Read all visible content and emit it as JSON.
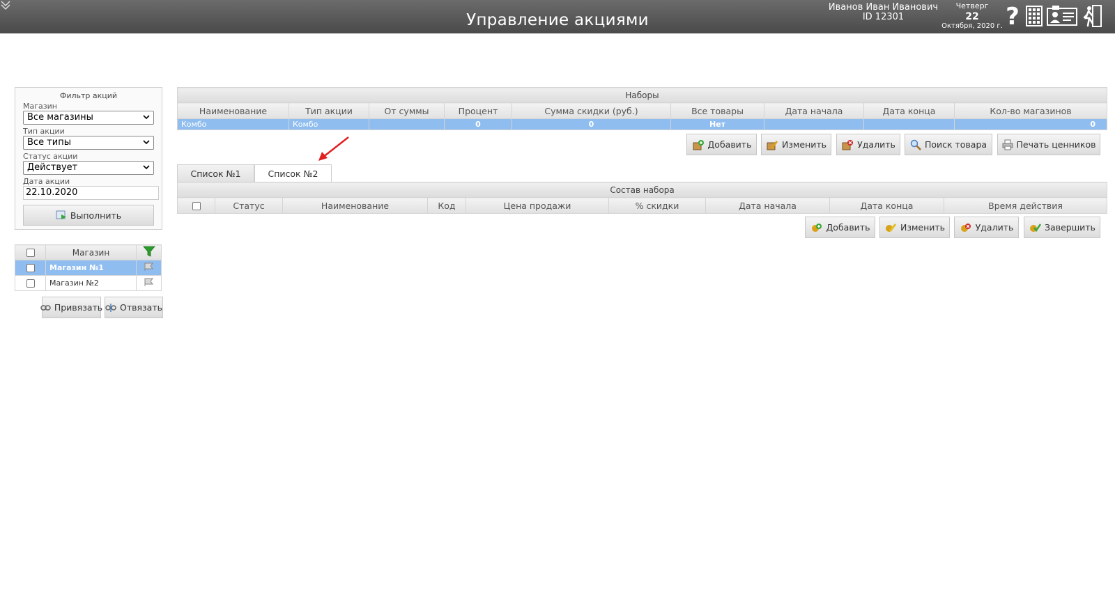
{
  "header": {
    "title": "Управление акциями",
    "user_name": "Иванов Иван Иванович",
    "user_id": "ID 12301",
    "date_weekday": "Четверг",
    "date_day": "22",
    "date_month": "Октября, 2020 г.",
    "help_glyph": "?",
    "icons": [
      "collapse-arrow-icon",
      "help-icon",
      "calculator-icon",
      "id-card-icon",
      "exit-icon"
    ]
  },
  "filter": {
    "title": "Фильтр акций",
    "store_label": "Магазин",
    "store_value": "Все магазины",
    "type_label": "Тип акции",
    "type_value": "Все типы",
    "status_label": "Статус акции",
    "status_value": "Действует",
    "date_label": "Дата акции",
    "date_value": "22.10.2020",
    "run_button": "Выполнить"
  },
  "stores": {
    "header": "Магазин",
    "rows": [
      {
        "name": "Магазин №1",
        "selected": true
      },
      {
        "name": "Магазин №2",
        "selected": false
      }
    ],
    "bind_button": "Привязать",
    "unbind_button": "Отвязать"
  },
  "sets": {
    "caption": "Наборы",
    "columns": [
      "Наименование",
      "Тип акции",
      "От суммы",
      "Процент",
      "Сумма скидки (руб.)",
      "Все товары",
      "Дата начала",
      "Дата конца",
      "Кол-во магазинов"
    ],
    "rows": [
      {
        "name": "Комбо",
        "type": "Комбо",
        "from_sum": "",
        "percent": "0",
        "discount_sum": "0",
        "all_goods": "Нет",
        "date_start": "",
        "date_end": "",
        "store_count": "0"
      }
    ],
    "buttons": {
      "add": "Добавить",
      "edit": "Изменить",
      "delete": "Удалить",
      "search": "Поиск товара",
      "print": "Печать ценников"
    }
  },
  "tabs": [
    "Список №1",
    "Список №2"
  ],
  "active_tab": "Список №2",
  "composition": {
    "caption": "Состав набора",
    "columns": [
      "",
      "Статус",
      "Наименование",
      "Код",
      "Цена продажи",
      "% скидки",
      "Дата начала",
      "Дата конца",
      "Время действия"
    ],
    "buttons": {
      "add": "Добавить",
      "edit": "Изменить",
      "delete": "Удалить",
      "finish": "Завершить"
    }
  },
  "colors": {
    "header_bg": "#555555",
    "selected_row": "#8fbdf0",
    "annotation_arrow": "#e02020"
  }
}
